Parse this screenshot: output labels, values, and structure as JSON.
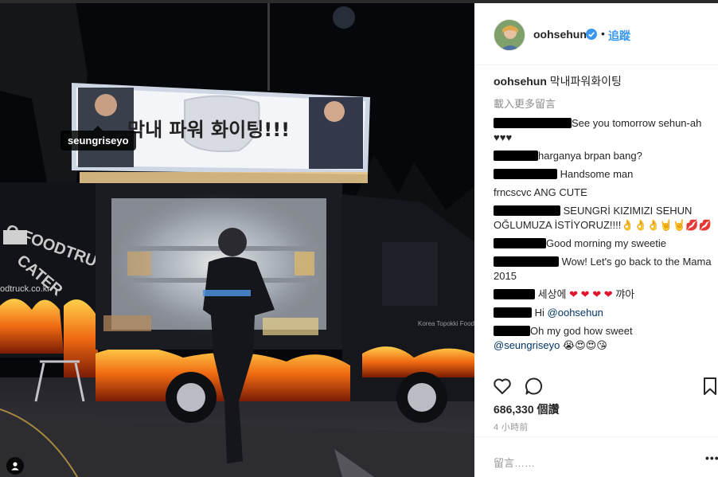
{
  "post": {
    "username": "oohsehun",
    "follow_label": "追蹤",
    "separator": "•",
    "caption_user": "oohsehun",
    "caption_text": "막내파워화이팅",
    "load_more": "載入更多留言",
    "photo_tag": "seungriseyo",
    "truck_banner": "막내 파워 화이팅!!!",
    "truck_side_text": "O FOODTRUCK CATER",
    "truck_site": "odtruck.co.kr",
    "truck_brand": "Korea Topokki Food Tr"
  },
  "comments": [
    {
      "user": "[redacted]",
      "text": "See you tomorrow sehun-ah ♥♥♥"
    },
    {
      "user": "[redacted]",
      "text": "harganya brpan bang?"
    },
    {
      "user": "[redacted]",
      "text": "Handsome man"
    },
    {
      "user": "frncscvc",
      "text": "ANG CUTE"
    },
    {
      "user": "[redacted]",
      "text": "SEUNGRİ KIZIMIZI SEHUN OĞLUMUZA İSTİYORUZ!!!!👌👌👌🤘🤘💋💋"
    },
    {
      "user": "[redacted]",
      "text": "Good morning my sweetie"
    },
    {
      "user": "[redacted]",
      "text": "Wow! Let's go back to the Mama 2015"
    },
    {
      "user": "[redacted]",
      "text": "세상에 ❤ ❤ ❤ ❤ 꺄아"
    },
    {
      "user": "[redacted]",
      "text": "Hi",
      "mention": "@oohsehun"
    },
    {
      "user": "[redacted]",
      "text": "Oh my god how sweet",
      "mention": "@seungriseyo",
      "emojis": "😭😍😍😘"
    }
  ],
  "stats": {
    "likes": "686,330 個讚",
    "time": "4 小時前"
  },
  "input": {
    "placeholder": "留言……",
    "more": "•••"
  },
  "icons": [
    "heart-icon",
    "comment-icon",
    "bookmark-icon",
    "verified-icon",
    "person-tag-icon",
    "more-options-icon"
  ],
  "colors": {
    "link": "#3897f0",
    "verified": "#3897f0",
    "text": "#262626",
    "muted": "#999999"
  }
}
